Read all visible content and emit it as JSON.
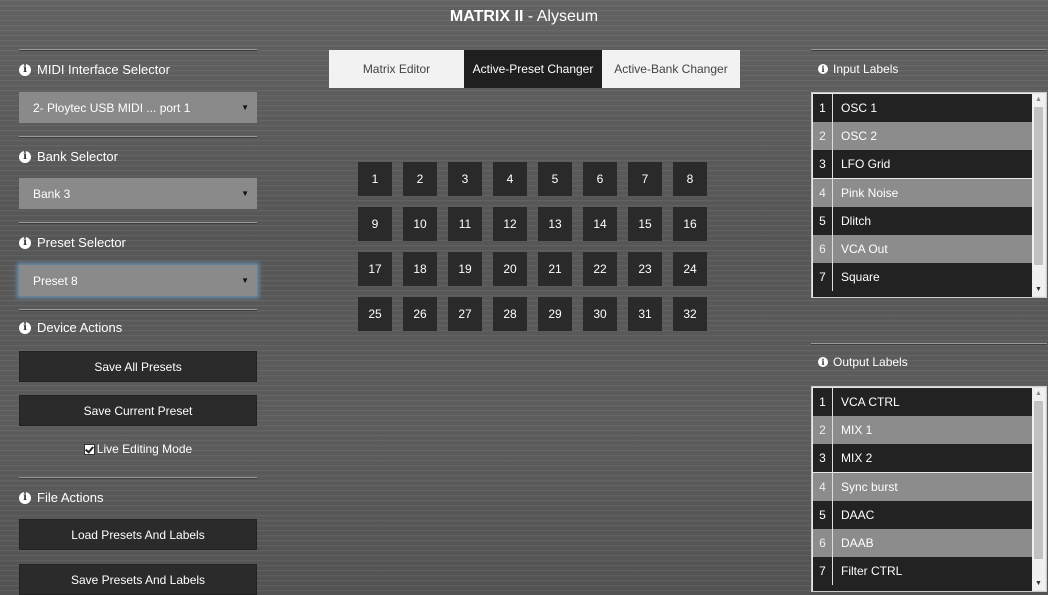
{
  "title": {
    "bold": "MATRIX II",
    "rest": " - Alyseum"
  },
  "sidebar": {
    "midi": {
      "label": "MIDI Interface Selector",
      "value": "2- Ploytec USB MIDI ... port 1"
    },
    "bank": {
      "label": "Bank Selector",
      "value": "Bank 3"
    },
    "preset": {
      "label": "Preset Selector",
      "value": "Preset 8"
    },
    "device_actions": {
      "label": "Device Actions",
      "save_all": "Save All Presets",
      "save_current": "Save Current Preset",
      "live_editing": "Live Editing Mode",
      "live_editing_checked": true
    },
    "file_actions": {
      "label": "File Actions",
      "load": "Load Presets And Labels",
      "save": "Save Presets And Labels"
    }
  },
  "tabs": [
    {
      "label": "Matrix Editor",
      "active": false
    },
    {
      "label": "Active-Preset Changer",
      "active": true
    },
    {
      "label": "Active-Bank Changer",
      "active": false
    }
  ],
  "presets": [
    "1",
    "2",
    "3",
    "4",
    "5",
    "6",
    "7",
    "8",
    "9",
    "10",
    "11",
    "12",
    "13",
    "14",
    "15",
    "16",
    "17",
    "18",
    "19",
    "20",
    "21",
    "22",
    "23",
    "24",
    "25",
    "26",
    "27",
    "28",
    "29",
    "30",
    "31",
    "32"
  ],
  "input_labels": {
    "title": "Input Labels",
    "items": [
      {
        "num": "1",
        "label": "OSC 1"
      },
      {
        "num": "2",
        "label": "OSC 2"
      },
      {
        "num": "3",
        "label": "LFO Grid"
      },
      {
        "num": "4",
        "label": "Pink Noise"
      },
      {
        "num": "5",
        "label": "Dlitch"
      },
      {
        "num": "6",
        "label": "VCA Out"
      },
      {
        "num": "7",
        "label": "Square"
      }
    ]
  },
  "output_labels": {
    "title": "Output Labels",
    "items": [
      {
        "num": "1",
        "label": "VCA CTRL"
      },
      {
        "num": "2",
        "label": "MIX 1"
      },
      {
        "num": "3",
        "label": "MIX 2"
      },
      {
        "num": "4",
        "label": "Sync burst"
      },
      {
        "num": "5",
        "label": "DAAC"
      },
      {
        "num": "6",
        "label": "DAAB"
      },
      {
        "num": "7",
        "label": "Filter CTRL"
      }
    ]
  },
  "icons": {
    "info": "info-icon",
    "caret": "caret-down-icon",
    "scroll_up": "scroll-up-arrow-icon",
    "scroll_down": "scroll-down-arrow-icon"
  }
}
